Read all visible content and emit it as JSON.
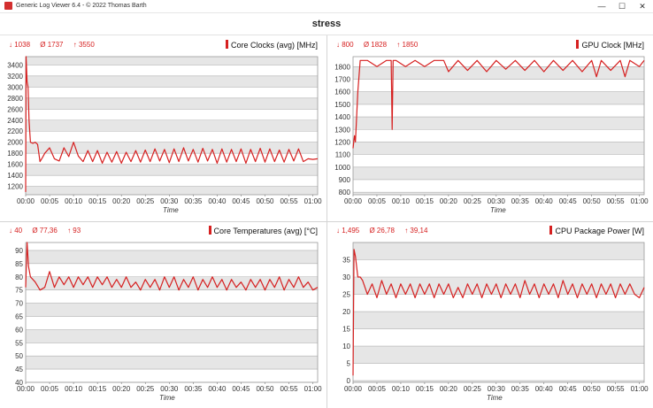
{
  "window": {
    "title": "Generic Log Viewer 6.4 - © 2022 Thomas Barth",
    "minimize": "—",
    "maximize": "☐",
    "close": "✕"
  },
  "banner": {
    "title": "stress"
  },
  "colors": {
    "line": "#d62020",
    "grid_band": "#e6e6e6",
    "grid_band_alt": "#ffffff"
  },
  "chart_data": [
    {
      "type": "line",
      "title": "Core Clocks (avg) [MHz]",
      "stats": {
        "min": "↓ 1038",
        "avg": "Ø 1737",
        "max": "↑ 3550"
      },
      "xlabel": "Time",
      "x_ticks": [
        "00:00",
        "00:05",
        "00:10",
        "00:15",
        "00:20",
        "00:25",
        "00:30",
        "00:35",
        "00:40",
        "00:45",
        "00:50",
        "00:55",
        "01:00"
      ],
      "y_ticks": [
        1200,
        1400,
        1600,
        1800,
        2000,
        2200,
        2400,
        2600,
        2800,
        3000,
        3200,
        3400
      ],
      "ylim": [
        1050,
        3550
      ],
      "xlim_minutes": [
        0,
        61
      ],
      "series": [
        {
          "x": [
            0,
            0.1,
            0.3,
            0.5,
            0.7,
            1,
            1.5,
            2,
            2.5,
            3,
            3.5,
            4,
            5,
            6,
            7,
            8,
            9,
            10,
            11,
            12,
            13,
            14,
            15,
            16,
            17,
            18,
            19,
            20,
            21,
            22,
            23,
            24,
            25,
            26,
            27,
            28,
            29,
            30,
            31,
            32,
            33,
            34,
            35,
            36,
            37,
            38,
            39,
            40,
            41,
            42,
            43,
            44,
            45,
            46,
            47,
            48,
            49,
            50,
            51,
            52,
            53,
            54,
            55,
            56,
            57,
            58,
            59,
            60,
            61
          ],
          "values": [
            1100,
            3550,
            3100,
            3000,
            2400,
            2000,
            1980,
            2000,
            1960,
            1650,
            1720,
            1800,
            1900,
            1700,
            1660,
            1900,
            1740,
            2000,
            1750,
            1650,
            1850,
            1650,
            1850,
            1620,
            1820,
            1640,
            1830,
            1620,
            1820,
            1650,
            1850,
            1640,
            1860,
            1650,
            1880,
            1660,
            1870,
            1630,
            1880,
            1650,
            1900,
            1660,
            1870,
            1640,
            1890,
            1660,
            1870,
            1620,
            1880,
            1640,
            1870,
            1650,
            1880,
            1620,
            1870,
            1650,
            1890,
            1640,
            1880,
            1650,
            1860,
            1640,
            1870,
            1660,
            1880,
            1650,
            1700,
            1690,
            1700
          ]
        }
      ]
    },
    {
      "type": "line",
      "title": "GPU Clock [MHz]",
      "stats": {
        "min": "↓ 800",
        "avg": "Ø 1828",
        "max": "↑ 1850"
      },
      "xlabel": "Time",
      "x_ticks": [
        "00:00",
        "00:05",
        "00:10",
        "00:15",
        "00:20",
        "00:25",
        "00:30",
        "00:35",
        "00:40",
        "00:45",
        "00:50",
        "00:55",
        "01:00"
      ],
      "y_ticks": [
        800,
        900,
        1000,
        1100,
        1200,
        1300,
        1400,
        1500,
        1600,
        1700,
        1800
      ],
      "ylim": [
        780,
        1880
      ],
      "xlim_minutes": [
        0,
        61
      ],
      "series": [
        {
          "x": [
            0,
            0.3,
            0.5,
            1,
            1.5,
            3,
            5,
            7,
            8,
            8.2,
            8.4,
            9,
            11,
            13,
            15,
            17,
            19,
            20,
            22,
            24,
            26,
            28,
            30,
            32,
            34,
            36,
            38,
            40,
            42,
            44,
            46,
            48,
            50,
            51,
            52,
            54,
            56,
            57,
            58,
            60,
            61
          ],
          "values": [
            1150,
            1250,
            1200,
            1600,
            1850,
            1850,
            1800,
            1850,
            1850,
            1300,
            1850,
            1850,
            1800,
            1850,
            1800,
            1850,
            1850,
            1760,
            1850,
            1770,
            1850,
            1760,
            1850,
            1780,
            1850,
            1770,
            1850,
            1760,
            1850,
            1770,
            1850,
            1760,
            1850,
            1720,
            1850,
            1770,
            1850,
            1720,
            1850,
            1800,
            1850
          ]
        }
      ]
    },
    {
      "type": "line",
      "title": "Core Temperatures (avg) [°C]",
      "stats": {
        "min": "↓ 40",
        "avg": "Ø 77,36",
        "max": "↑ 93"
      },
      "xlabel": "Time",
      "x_ticks": [
        "00:00",
        "00:05",
        "00:10",
        "00:15",
        "00:20",
        "00:25",
        "00:30",
        "00:35",
        "00:40",
        "00:45",
        "00:50",
        "00:55",
        "01:00"
      ],
      "y_ticks": [
        40,
        45,
        50,
        55,
        60,
        65,
        70,
        75,
        80,
        85,
        90
      ],
      "ylim": [
        40,
        93
      ],
      "xlim_minutes": [
        0,
        61
      ],
      "series": [
        {
          "x": [
            0,
            0.3,
            0.6,
            1,
            1.5,
            2,
            3,
            4,
            5,
            6,
            7,
            8,
            9,
            10,
            11,
            12,
            13,
            14,
            15,
            16,
            17,
            18,
            19,
            20,
            21,
            22,
            23,
            24,
            25,
            26,
            27,
            28,
            29,
            30,
            31,
            32,
            33,
            34,
            35,
            36,
            37,
            38,
            39,
            40,
            41,
            42,
            43,
            44,
            45,
            46,
            47,
            48,
            49,
            50,
            51,
            52,
            53,
            54,
            55,
            56,
            57,
            58,
            59,
            60,
            61
          ],
          "values": [
            76,
            93,
            84,
            80,
            79,
            78,
            75,
            76,
            82,
            76,
            80,
            77,
            80,
            76,
            80,
            77,
            80,
            76,
            80,
            77,
            80,
            76,
            79,
            76,
            80,
            76,
            78,
            75,
            79,
            76,
            79,
            75,
            80,
            76,
            80,
            75,
            79,
            76,
            80,
            75,
            79,
            76,
            80,
            76,
            79,
            75,
            79,
            76,
            78,
            75,
            79,
            76,
            79,
            75,
            79,
            76,
            80,
            75,
            79,
            76,
            80,
            76,
            78,
            75,
            76
          ]
        }
      ]
    },
    {
      "type": "line",
      "title": "CPU Package Power [W]",
      "stats": {
        "min": "↓ 1,495",
        "avg": "Ø 26,78",
        "max": "↑ 39,14"
      },
      "xlabel": "Time",
      "x_ticks": [
        "00:00",
        "00:05",
        "00:10",
        "00:15",
        "00:20",
        "00:25",
        "00:30",
        "00:35",
        "00:40",
        "00:45",
        "00:50",
        "00:55",
        "01:00"
      ],
      "y_ticks": [
        0,
        5,
        10,
        15,
        20,
        25,
        30,
        35
      ],
      "ylim": [
        -0.5,
        40
      ],
      "xlim_minutes": [
        0,
        61
      ],
      "series": [
        {
          "x": [
            0,
            0.2,
            0.5,
            1,
            1.5,
            2,
            3,
            4,
            5,
            6,
            7,
            8,
            9,
            10,
            11,
            12,
            13,
            14,
            15,
            16,
            17,
            18,
            19,
            20,
            21,
            22,
            23,
            24,
            25,
            26,
            27,
            28,
            29,
            30,
            31,
            32,
            33,
            34,
            35,
            36,
            37,
            38,
            39,
            40,
            41,
            42,
            43,
            44,
            45,
            46,
            47,
            48,
            49,
            50,
            51,
            52,
            53,
            54,
            55,
            56,
            57,
            58,
            59,
            60,
            61
          ],
          "values": [
            1.5,
            38,
            36,
            30,
            30,
            29,
            25,
            28,
            24,
            29,
            25,
            28,
            24,
            28,
            25,
            28,
            24,
            28,
            25,
            28,
            24,
            28,
            25,
            28,
            24,
            27,
            24,
            28,
            25,
            28,
            24,
            28,
            25,
            28,
            24,
            28,
            25,
            28,
            24,
            29,
            25,
            28,
            24,
            28,
            25,
            28,
            24,
            29,
            25,
            28,
            24,
            28,
            25,
            28,
            24,
            28,
            25,
            28,
            24,
            28,
            25,
            28,
            25,
            24,
            27
          ]
        }
      ]
    }
  ]
}
